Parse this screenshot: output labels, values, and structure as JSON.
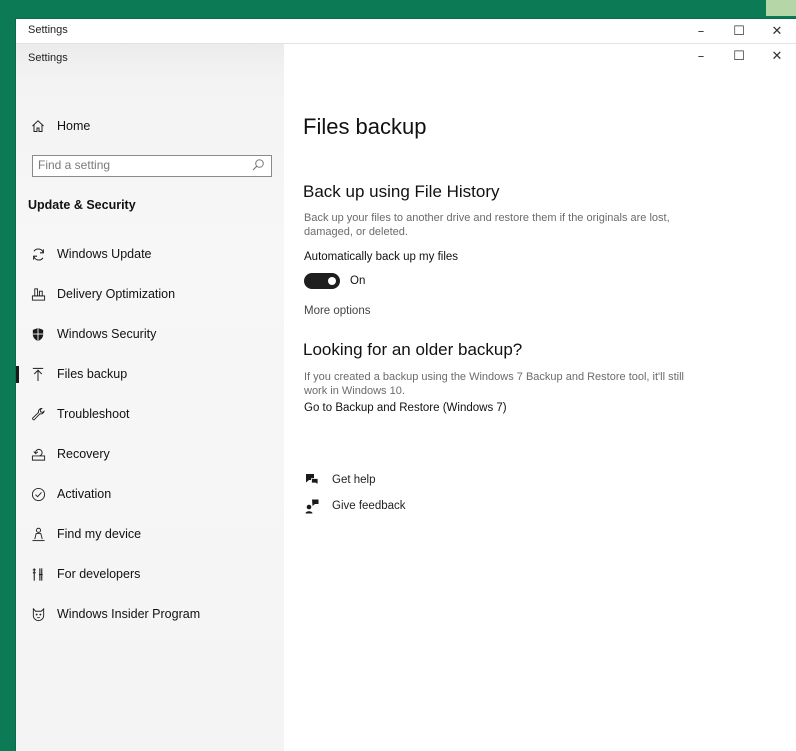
{
  "outer_window": {
    "title": "Settings",
    "controls": {
      "minimize": "–",
      "maximize": "☐",
      "close": "✕"
    }
  },
  "inner_window": {
    "title": "Settings",
    "controls": {
      "minimize": "–",
      "maximize": "☐",
      "close": "✕"
    }
  },
  "sidebar": {
    "home_label": "Home",
    "search_placeholder": "Find a setting",
    "section_heading": "Update & Security",
    "items": [
      {
        "label": "Windows Update",
        "icon": "refresh-icon"
      },
      {
        "label": "Delivery Optimization",
        "icon": "delivery-optimization-icon"
      },
      {
        "label": "Windows Security",
        "icon": "shield-icon"
      },
      {
        "label": "Files backup",
        "icon": "backup-arrow-icon",
        "selected": true
      },
      {
        "label": "Troubleshoot",
        "icon": "wrench-icon"
      },
      {
        "label": "Recovery",
        "icon": "recovery-icon"
      },
      {
        "label": "Activation",
        "icon": "check-circle-icon"
      },
      {
        "label": "Find my device",
        "icon": "person-location-icon"
      },
      {
        "label": "For developers",
        "icon": "developer-icon"
      },
      {
        "label": "Windows Insider Program",
        "icon": "insider-cat-icon"
      }
    ]
  },
  "main": {
    "page_title": "Files backup",
    "file_history": {
      "heading": "Back up using File History",
      "description": "Back up your files to another drive and restore them if the originals are lost, damaged, or deleted.",
      "auto_label": "Automatically back up my files",
      "toggle_state": "On",
      "toggle_on": true,
      "more_options": "More options"
    },
    "older_backup": {
      "heading": "Looking for an older backup?",
      "description": "If you created a backup using the Windows 7 Backup and Restore tool, it'll still work in Windows 10.",
      "link": "Go to Backup and Restore (Windows 7)"
    },
    "help": {
      "get_help": "Get help",
      "give_feedback": "Give feedback"
    }
  },
  "colors": {
    "desktop_background": "#0b7a55",
    "toggle_on": "#1e1e1e",
    "sidebar_background": "#f4f4f4"
  }
}
